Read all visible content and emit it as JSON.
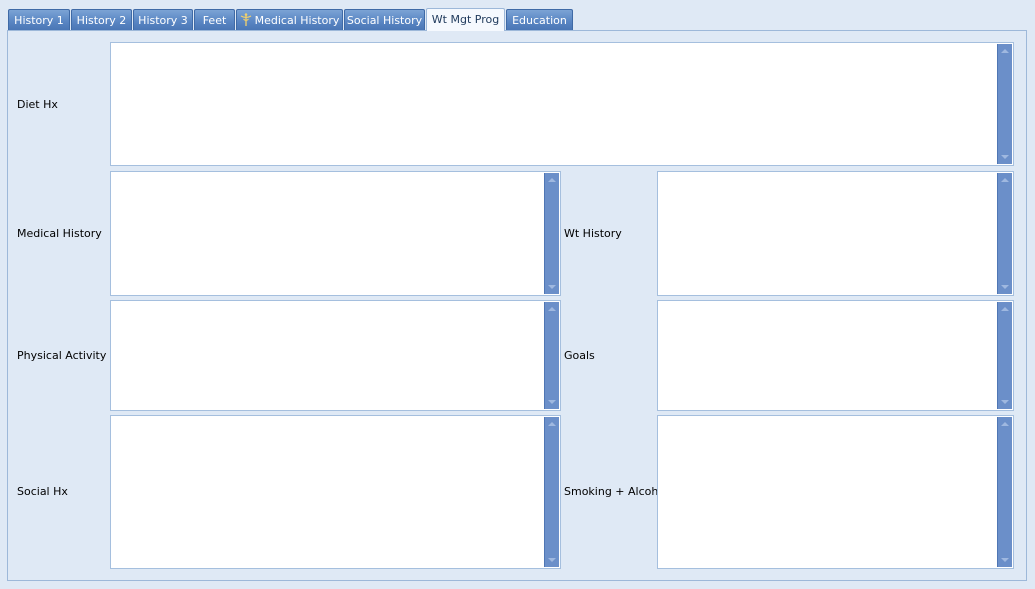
{
  "tabs": [
    {
      "label": "History 1"
    },
    {
      "label": "History 2"
    },
    {
      "label": "History 3"
    },
    {
      "label": "Feet"
    },
    {
      "label": "Medical History",
      "icon": "caduceus-icon"
    },
    {
      "label": "Social History"
    },
    {
      "label": "Wt Mgt Prog",
      "active": true
    },
    {
      "label": "Education"
    }
  ],
  "fields": {
    "diet_hx": {
      "label": "Diet Hx",
      "value": ""
    },
    "medical_history": {
      "label": "Medical History",
      "value": ""
    },
    "wt_history": {
      "label": "Wt History",
      "value": ""
    },
    "physical_activity": {
      "label": "Physical Activity",
      "value": ""
    },
    "goals": {
      "label": "Goals",
      "value": ""
    },
    "social_hx": {
      "label": "Social Hx",
      "value": ""
    },
    "smoking_alcohol": {
      "label": "Smoking + Alcohol",
      "value": ""
    }
  },
  "colors": {
    "tab_inactive": "#5b87c4",
    "tab_active": "#f5f9fe",
    "background": "#dfe9f5",
    "scrollbar": "#6b8fc9"
  }
}
